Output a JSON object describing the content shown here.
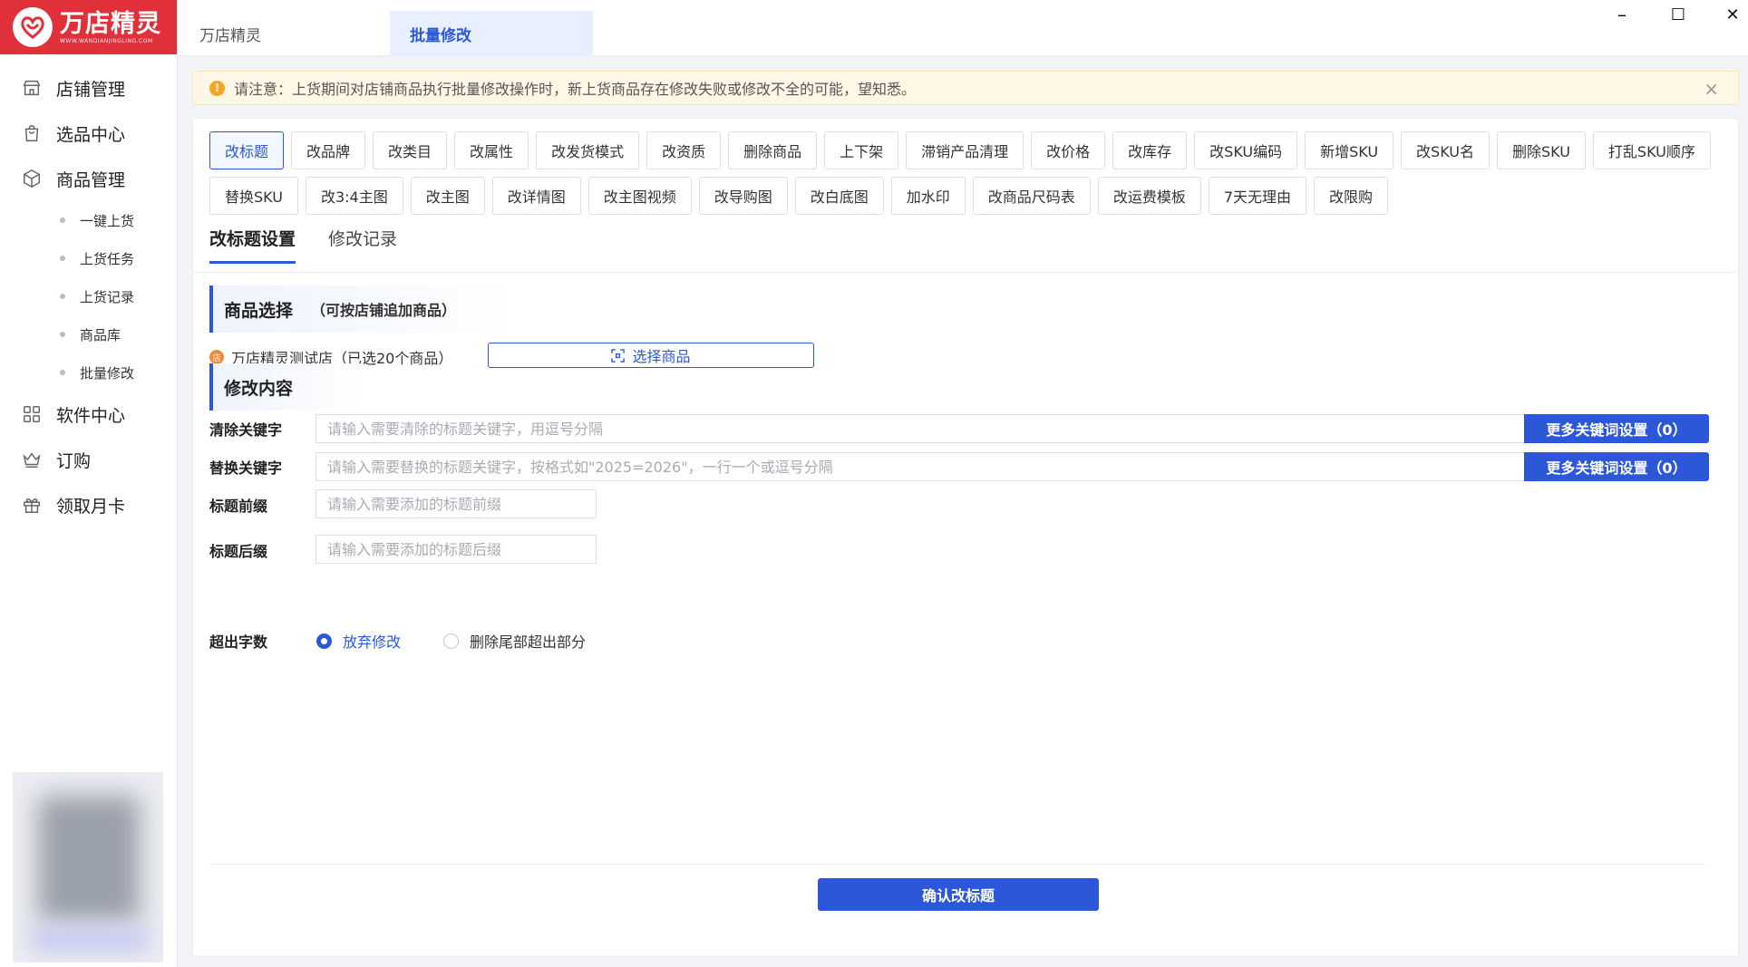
{
  "app": {
    "name": "万店精灵",
    "logo_sub": "WWW.WANDIANJINGLING.COM"
  },
  "window_controls": {
    "minimize": "–",
    "maximize": "☐",
    "close": "✕"
  },
  "tabs": [
    {
      "label": "万店精灵"
    },
    {
      "label": "批量修改"
    }
  ],
  "sidebar": {
    "items": [
      {
        "label": "店铺管理",
        "icon": "store-icon"
      },
      {
        "label": "选品中心",
        "icon": "shopping-bag-icon"
      },
      {
        "label": "商品管理",
        "icon": "box-icon"
      }
    ],
    "sub_items": [
      {
        "label": "一键上货"
      },
      {
        "label": "上货任务"
      },
      {
        "label": "上货记录"
      },
      {
        "label": "商品库"
      },
      {
        "label": "批量修改"
      }
    ],
    "items2": [
      {
        "label": "软件中心",
        "icon": "grid-icon"
      },
      {
        "label": "订购",
        "icon": "crown-icon"
      },
      {
        "label": "领取月卡",
        "icon": "gift-icon"
      }
    ]
  },
  "notice": {
    "text": "请注意：上货期间对店铺商品执行批量修改操作时，新上货商品存在修改失败或修改不全的可能，望知悉。"
  },
  "ops": [
    "改标题",
    "改品牌",
    "改类目",
    "改属性",
    "改发货模式",
    "改资质",
    "删除商品",
    "上下架",
    "滞销产品清理",
    "改价格",
    "改库存",
    "改SKU编码",
    "新增SKU",
    "改SKU名",
    "删除SKU",
    "打乱SKU顺序",
    "替换SKU",
    "改3:4主图",
    "改主图",
    "改详情图",
    "改主图视频",
    "改导购图",
    "改白底图",
    "加水印",
    "改商品尺码表",
    "改运费模板",
    "7天无理由",
    "改限购"
  ],
  "subtabs": [
    {
      "label": "改标题设置"
    },
    {
      "label": "修改记录"
    }
  ],
  "product_section": {
    "title": "商品选择",
    "subtitle": "（可按店铺追加商品）",
    "shop": "万店精灵测试店（已选20个商品）",
    "select_button": "选择商品"
  },
  "modify_section": {
    "title": "修改内容",
    "clear_label": "清除关键字",
    "clear_placeholder": "请输入需要清除的标题关键字，用逗号分隔",
    "replace_label": "替换关键字",
    "replace_placeholder": "请输入需要替换的标题关键字，按格式如\"2025=2026\"，一行一个或逗号分隔",
    "more_button": "更多关键词设置（0）",
    "prefix_label": "标题前缀",
    "prefix_placeholder": "请输入需要添加的标题前缀",
    "suffix_label": "标题后缀",
    "suffix_placeholder": "请输入需要添加的标题后缀",
    "overflow_label": "超出字数",
    "radio_options": [
      {
        "label": "放弃修改",
        "checked": true
      },
      {
        "label": "删除尾部超出部分",
        "checked": false
      }
    ]
  },
  "confirm_button": "确认改标题",
  "colors": {
    "brand_red": "#e0303a",
    "primary_blue": "#2c57d9",
    "notice_bg": "#fff7e6",
    "warn": "#f5a623"
  }
}
